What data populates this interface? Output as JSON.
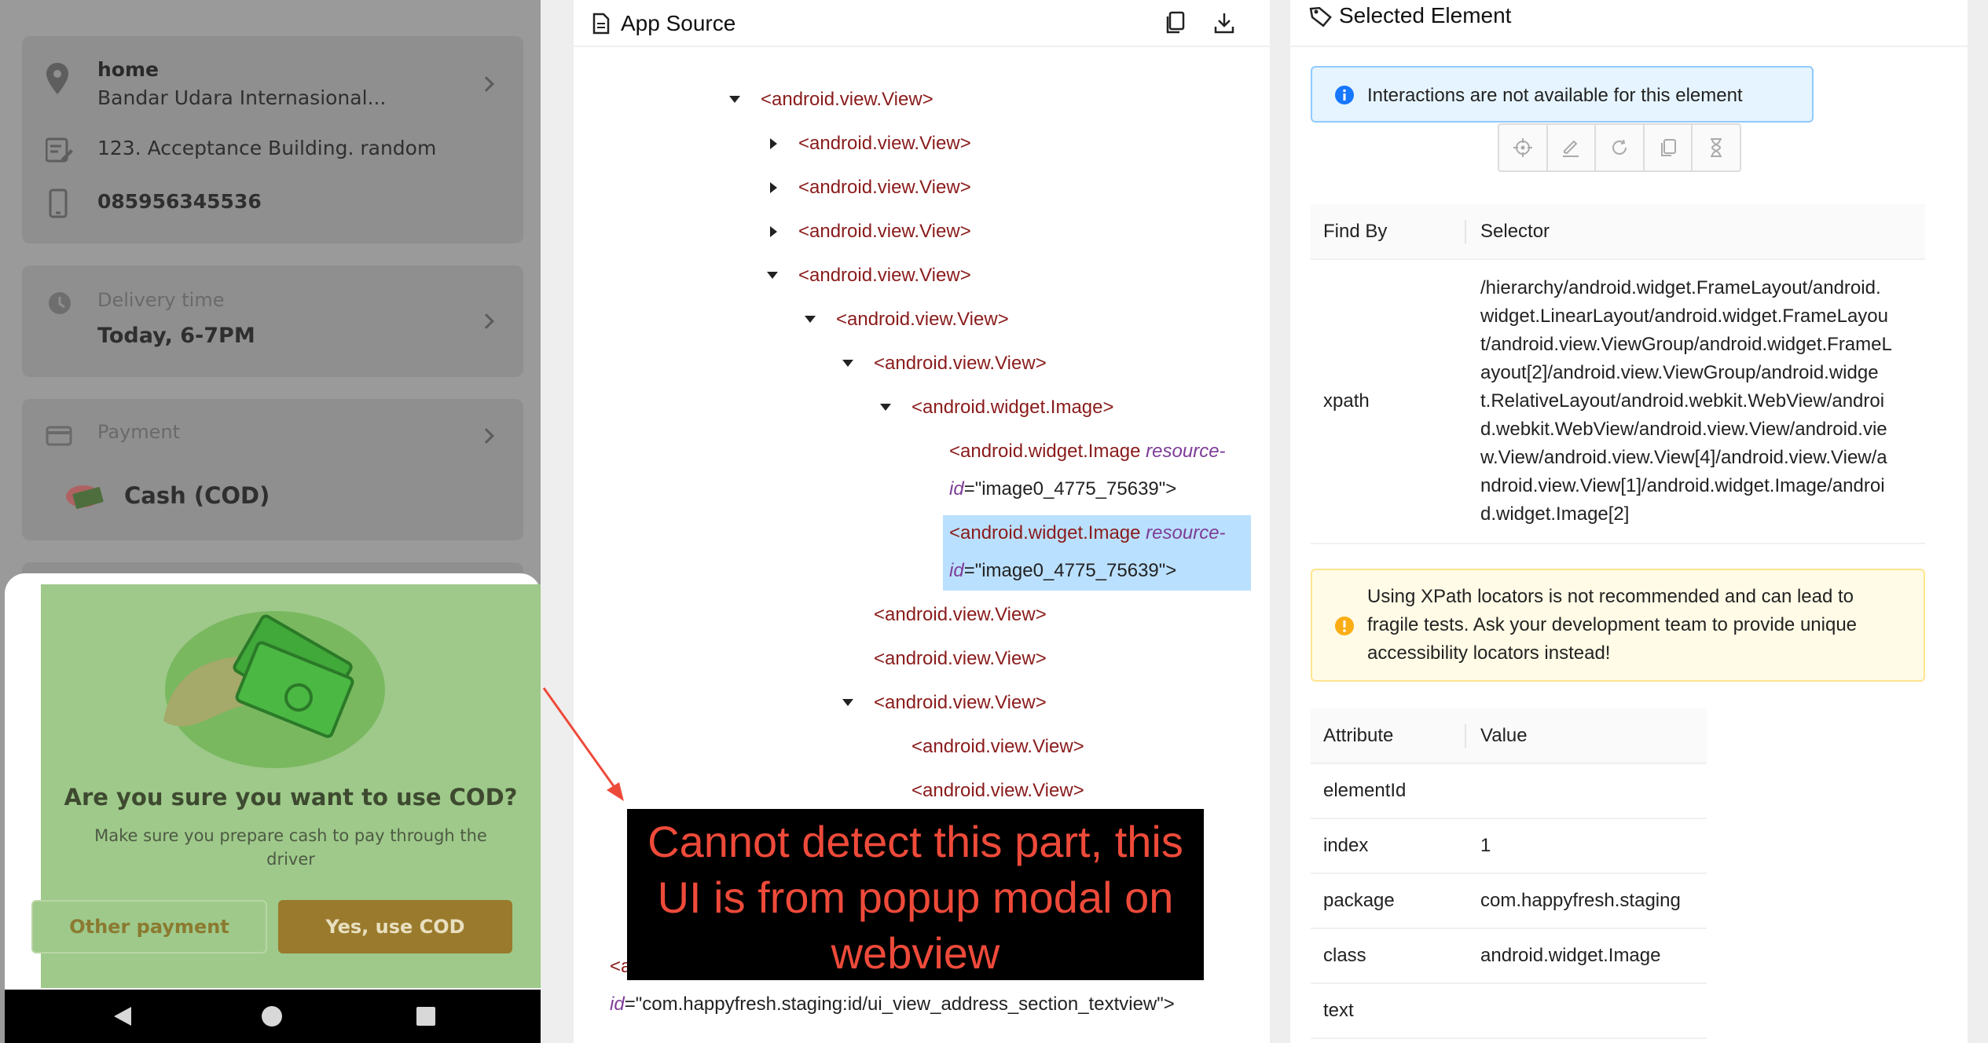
{
  "phone": {
    "address": {
      "title": "home",
      "location": "Bandar Udara Internasional...",
      "detail": "123. Acceptance Building. random",
      "phone": "085956345536"
    },
    "delivery": {
      "label": "Delivery time",
      "value": "Today, 6-7PM"
    },
    "payment": {
      "label": "Payment",
      "method": "Cash (COD)"
    },
    "modal": {
      "question": "Are you sure you want to use COD?",
      "description_line1": "Make sure you prepare cash to pay through the",
      "description_line2": "driver",
      "secondary_button": "Other payment",
      "primary_button": "Yes, use COD"
    }
  },
  "source": {
    "title": "App Source",
    "rows": [
      {
        "text": "<android.view.View>",
        "caret": "down"
      },
      {
        "text": "<android.view.View>",
        "caret": "right"
      },
      {
        "text": "<android.view.View>",
        "caret": "right"
      },
      {
        "text": "<android.view.View>",
        "caret": "right"
      },
      {
        "text": "<android.view.View>",
        "caret": "down"
      },
      {
        "text": "<android.view.View>",
        "caret": "down"
      },
      {
        "text": "<android.view.View>",
        "caret": "down"
      },
      {
        "text": "<android.widget.Image>",
        "caret": "down"
      },
      {
        "tag": "<android.widget.Image",
        "attr": "resource-",
        "attr2": "id",
        "value": "=\"image0_4775_75639\">"
      },
      {
        "tag": "<android.widget.Image",
        "attr": "resource-",
        "attr2": "id",
        "value": "=\"image0_4775_75639\">",
        "selected": true
      },
      {
        "text": "<android.view.View>",
        "caret": "none"
      },
      {
        "text": "<android.view.View>",
        "caret": "none"
      },
      {
        "text": "<android.view.View>",
        "caret": "down"
      },
      {
        "text": "<android.view.View>",
        "caret": "none"
      },
      {
        "text": "<android.view.View>",
        "caret": "none"
      }
    ],
    "bottom_row": {
      "prefix": "<a",
      "attr": "id",
      "value": "=\"com.happyfresh.staging:id/ui_view_address_section_textview\">"
    }
  },
  "annotation": {
    "line1": "Cannot detect this part, this",
    "line2": "UI is from popup modal on",
    "line3": "webview",
    "color": "#ee4a3a"
  },
  "selected": {
    "title": "Selected Element",
    "info": "Interactions are not available for this element",
    "find_header": "Find By",
    "selector_header": "Selector",
    "find_by": "xpath",
    "xpath_lines": [
      "/hierarchy/android.widget.FrameLayout/android.",
      "widget.LinearLayout/android.widget.FrameLayou",
      "t/android.view.ViewGroup/android.widget.FrameL",
      "ayout[2]/android.view.ViewGroup/android.widge",
      "t.RelativeLayout/android.webkit.WebView/androi",
      "d.webkit.WebView/android.view.View/android.vie",
      "w.View/android.view.View[4]/android.view.View/a",
      "ndroid.view.View[1]/android.widget.Image/androi",
      "d.widget.Image[2]"
    ],
    "warning_lines": [
      "Using XPath locators is not recommended and can lead to",
      "fragile tests. Ask your development team to provide unique",
      "accessibility locators instead!"
    ],
    "attr_header": "Attribute",
    "value_header": "Value",
    "attributes": [
      {
        "name": "elementId",
        "value": ""
      },
      {
        "name": "index",
        "value": "1"
      },
      {
        "name": "package",
        "value": "com.happyfresh.staging"
      },
      {
        "name": "class",
        "value": "android.widget.Image"
      },
      {
        "name": "text",
        "value": ""
      }
    ]
  },
  "colors": {
    "accent_blue": "#1677ff",
    "warning": "#faad14",
    "modal_green": "#9ec98a",
    "primary_button": "#9a7a2c",
    "selected_row": "#bae0ff"
  }
}
